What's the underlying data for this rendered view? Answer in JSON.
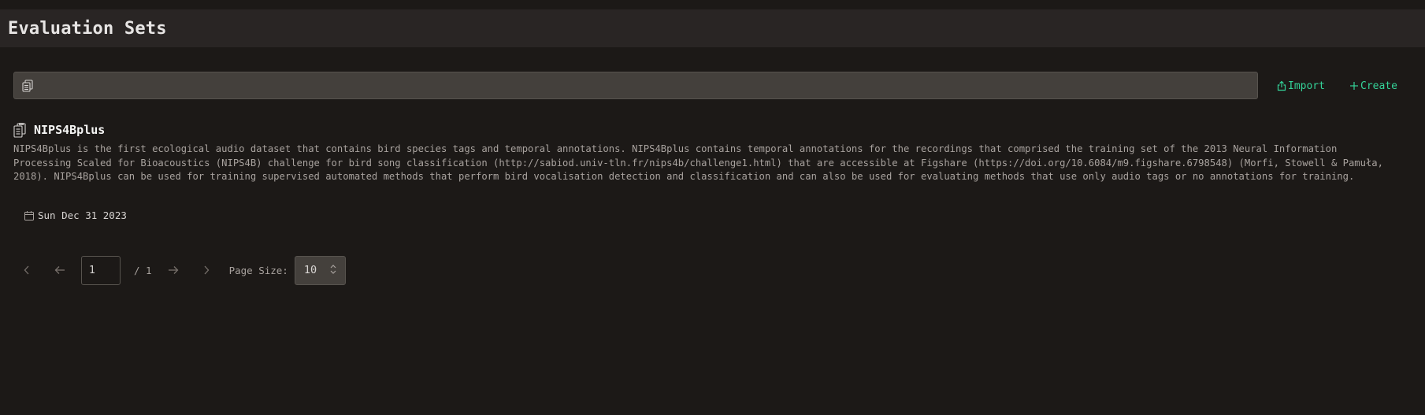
{
  "header": {
    "title": "Evaluation Sets"
  },
  "search": {
    "placeholder": "",
    "value": ""
  },
  "actions": {
    "import_label": "Import",
    "create_label": "Create"
  },
  "sets": [
    {
      "name": "NIPS4Bplus",
      "description": "NIPS4Bplus is the first ecological audio dataset that contains bird species tags and temporal annotations. NIPS4Bplus contains temporal annotations for the recordings that comprised the training set of the 2013 Neural Information Processing Scaled for Bioacoustics (NIPS4B) challenge for bird song classification (http://sabiod.univ-tln.fr/nips4b/challenge1.html) that are accessible at Figshare (https://doi.org/10.6084/m9.figshare.6798548) (Morfi, Stowell & Pamuła, 2018). NIPS4Bplus can be used for training supervised automated methods that perform bird vocalisation detection and classification and can also be used for evaluating methods that use only audio tags or no annotations for training.",
      "date": "Sun Dec 31 2023"
    }
  ],
  "pagination": {
    "current_page": "1",
    "total_label": "/ 1",
    "page_size_label": "Page Size:",
    "page_size_value": "10"
  },
  "colors": {
    "accent": "#34d399",
    "background": "#1c1917",
    "header_background": "#292524",
    "input_background": "#44403c"
  },
  "icons": {
    "search": "clipboard-copy-icon",
    "import": "upload-icon",
    "create": "plus-icon",
    "set": "clipboard-copy-icon",
    "date": "calendar-icon",
    "first": "chevron-left-icon",
    "prev": "arrow-left-icon",
    "next": "arrow-right-icon",
    "last": "chevron-right-icon",
    "page_size": "chevron-up-down-icon"
  }
}
